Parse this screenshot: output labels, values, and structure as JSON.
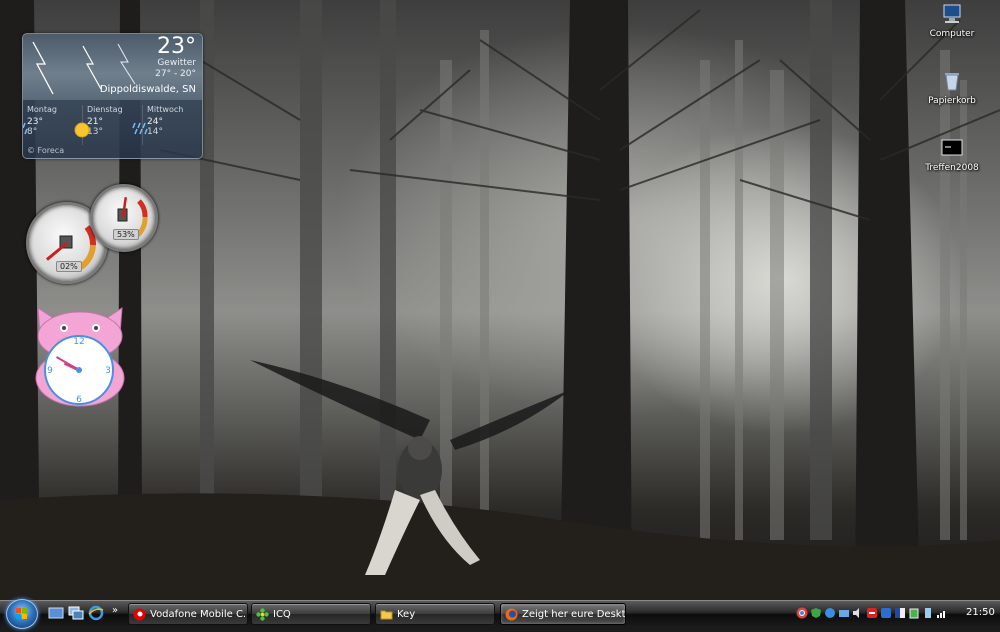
{
  "weather": {
    "temperature": "23°",
    "condition": "Gewitter",
    "range": "27° - 20°",
    "location": "Dippoldiswalde, SN",
    "forecast": [
      {
        "day": "Montag",
        "high": "23°",
        "low": "8°",
        "icon": "rain-icon"
      },
      {
        "day": "Dienstag",
        "high": "21°",
        "low": "13°",
        "icon": "sun-icon"
      },
      {
        "day": "Mittwoch",
        "high": "24°",
        "low": "14°",
        "icon": "rain-icon"
      }
    ],
    "credit": "© Foreca"
  },
  "meters": {
    "cpu": "02%",
    "ram": "53%",
    "cpu_level": 0.02,
    "ram_level": 0.53
  },
  "clock": {
    "hour": 21,
    "minute": 50,
    "face_color": "#ffffff",
    "frame_color": "#f3a6d6"
  },
  "desktop_icons": [
    {
      "label": "Computer",
      "icon": "computer-icon"
    },
    {
      "label": "Papierkorb",
      "icon": "recycle-bin-icon"
    },
    {
      "label": "Treffen2008",
      "icon": "video-file-icon"
    }
  ],
  "taskbar": {
    "start_label": "Start",
    "overflow": "»",
    "quick_launch": [
      "show-desktop-icon",
      "switch-windows-icon",
      "internet-explorer-icon"
    ],
    "buttons": [
      {
        "label": "Vodafone Mobile C...",
        "icon": "vodafone-icon"
      },
      {
        "label": "ICQ",
        "icon": "icq-flower-icon"
      },
      {
        "label": "Key",
        "icon": "folder-icon"
      },
      {
        "label": "Zeigt her eure Deskt...",
        "icon": "firefox-icon",
        "active": true
      }
    ],
    "tray_icons": [
      "chrome-icon",
      "security-icon",
      "network-icon",
      "network-icon",
      "volume-icon",
      "antivirus-icon",
      "bluetooth-icon",
      "language-icon",
      "battery-icon",
      "usb-icon",
      "network-signal-icon"
    ],
    "time": "21:50"
  }
}
